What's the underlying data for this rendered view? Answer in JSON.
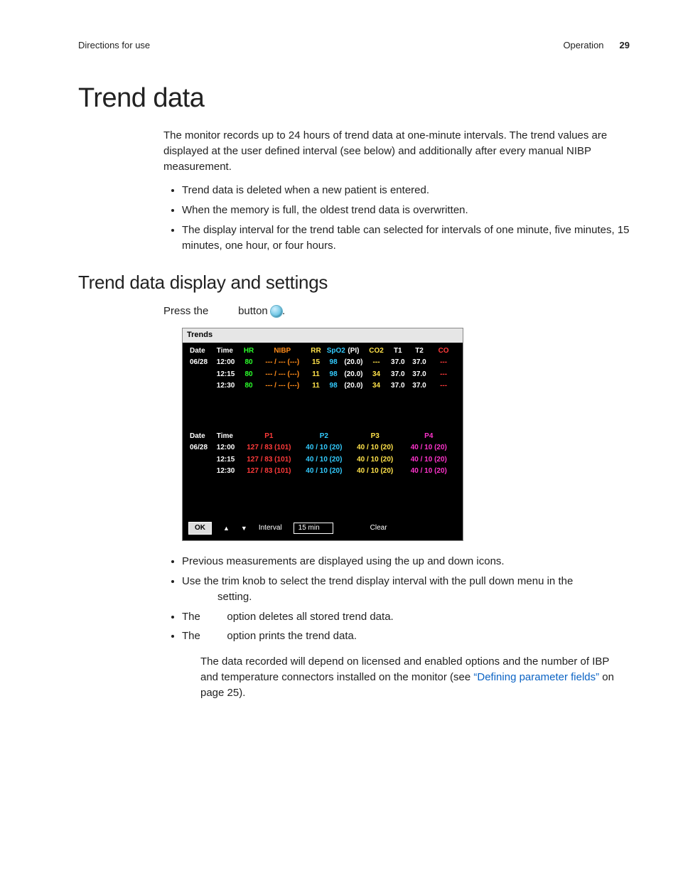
{
  "header": {
    "left": "Directions for use",
    "section": "Operation",
    "page": "29"
  },
  "h1": "Trend data",
  "intro": "The monitor records up to 24 hours of trend data at one-minute intervals. The trend values are displayed at the user defined interval (see below) and additionally after every manual NIBP measurement.",
  "bullets1": [
    "Trend data is deleted when a new patient is entered.",
    "When the memory is full, the oldest trend data is overwritten.",
    "The display interval for the trend table can selected for intervals of one minute, five minutes, 15 minutes, one hour, or four hours."
  ],
  "h2": "Trend data display and settings",
  "press": {
    "a": "Press the",
    "b": "button",
    "c": "."
  },
  "shot": {
    "title": "Trends",
    "hdr1": [
      "Date",
      "Time",
      "HR",
      "NIBP",
      "RR",
      "SpO2",
      "(PI)",
      "CO2",
      "T1",
      "T2",
      "CO"
    ],
    "rows1": [
      {
        "date": "06/28",
        "time": "12:00",
        "hr": "80",
        "nibp": "--- / --- (---)",
        "rr": "15",
        "spo2": "98",
        "pi": "(20.0)",
        "co2": "---",
        "t1": "37.0",
        "t2": "37.0",
        "co": "---"
      },
      {
        "date": "",
        "time": "12:15",
        "hr": "80",
        "nibp": "--- / --- (---)",
        "rr": "11",
        "spo2": "98",
        "pi": "(20.0)",
        "co2": "34",
        "t1": "37.0",
        "t2": "37.0",
        "co": "---"
      },
      {
        "date": "",
        "time": "12:30",
        "hr": "80",
        "nibp": "--- / --- (---)",
        "rr": "11",
        "spo2": "98",
        "pi": "(20.0)",
        "co2": "34",
        "t1": "37.0",
        "t2": "37.0",
        "co": "---"
      }
    ],
    "hdr2": [
      "Date",
      "Time",
      "P1",
      "P2",
      "P3",
      "P4"
    ],
    "rows2": [
      {
        "date": "06/28",
        "time": "12:00",
        "p1": "127 / 83 (101)",
        "p2": "40 / 10 (20)",
        "p3": "40 / 10 (20)",
        "p4": "40 / 10 (20)"
      },
      {
        "date": "",
        "time": "12:15",
        "p1": "127 / 83 (101)",
        "p2": "40 / 10 (20)",
        "p3": "40 / 10 (20)",
        "p4": "40 / 10 (20)"
      },
      {
        "date": "",
        "time": "12:30",
        "p1": "127 / 83 (101)",
        "p2": "40 / 10 (20)",
        "p3": "40 / 10 (20)",
        "p4": "40 / 10 (20)"
      }
    ],
    "ok": "OK",
    "interval_label": "Interval",
    "interval_value": "15 min",
    "clear": "Clear"
  },
  "bullets2": {
    "b1": "Previous measurements are displayed using the up and down icons.",
    "b2a": "Use the trim knob to select the trend display interval with the pull down menu in the",
    "b2b": "setting.",
    "b3a": "The",
    "b3b": "option deletes all stored trend data.",
    "b4a": "The",
    "b4b": "option prints the trend data."
  },
  "note": {
    "a": "The data recorded will depend on licensed and enabled options and the number of IBP and temperature connectors installed on the monitor (see ",
    "link": "“Defining parameter fields”",
    "b": " on page 25)."
  }
}
